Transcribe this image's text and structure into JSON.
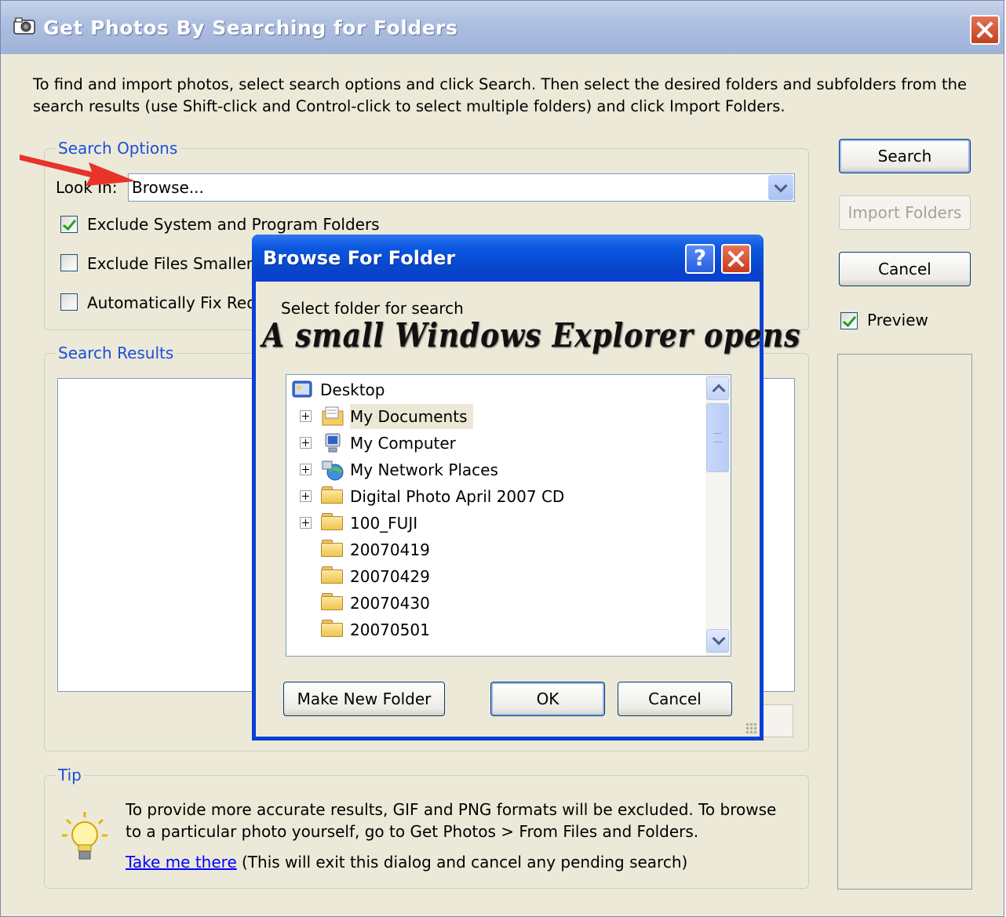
{
  "window": {
    "title": "Get Photos By Searching for Folders",
    "intro_text": "To find and import photos, select search options and click Search. Then select the desired folders and subfolders from the search results (use Shift-click and Control-click to select multiple folders) and click Import Folders."
  },
  "search_options": {
    "legend": "Search Options",
    "look_in_label": "Look In:",
    "look_in_value": "Browse...",
    "exclude_system_label": "Exclude System and Program Folders",
    "exclude_system_checked": true,
    "exclude_small_label": "Exclude Files Smaller T",
    "exclude_small_checked": false,
    "auto_fix_label": "Automatically Fix Red",
    "auto_fix_checked": false
  },
  "search_results": {
    "legend": "Search Results"
  },
  "right_panel": {
    "search_button": "Search",
    "import_button": "Import Folders",
    "cancel_button": "Cancel",
    "preview_label": "Preview",
    "preview_checked": true
  },
  "tip": {
    "legend": "Tip",
    "text": "To provide more accurate results, GIF and PNG formats will be excluded. To browse to a particular photo yourself, go to Get Photos > From Files and Folders.",
    "link_text": "Take me there",
    "link_note": "(This will exit this dialog and cancel any pending search)"
  },
  "browse_dialog": {
    "title": "Browse For Folder",
    "help_label": "?",
    "prompt": "Select folder for search",
    "annotation": "A small Windows Explorer opens",
    "tree": [
      {
        "label": "Desktop",
        "icon": "desktop-icon",
        "expandable": false
      },
      {
        "label": "My Documents",
        "icon": "my-documents-icon",
        "expandable": true,
        "selected": true
      },
      {
        "label": "My Computer",
        "icon": "my-computer-icon",
        "expandable": true
      },
      {
        "label": "My Network Places",
        "icon": "network-places-icon",
        "expandable": true
      },
      {
        "label": "Digital Photo April 2007 CD",
        "icon": "folder-icon",
        "expandable": true
      },
      {
        "label": "100_FUJI",
        "icon": "folder-icon",
        "expandable": true
      },
      {
        "label": "20070419",
        "icon": "folder-icon",
        "expandable": false
      },
      {
        "label": "20070429",
        "icon": "folder-icon",
        "expandable": false
      },
      {
        "label": "20070430",
        "icon": "folder-icon",
        "expandable": false
      },
      {
        "label": "20070501",
        "icon": "folder-icon",
        "expandable": false
      }
    ],
    "make_new_folder_button": "Make New Folder",
    "ok_button": "OK",
    "cancel_button": "Cancel"
  },
  "colors": {
    "xp_blue": "#0a3fd6",
    "legend_blue": "#1b4fd8",
    "arrow_red": "#e8322a",
    "dialog_bg": "#ece9d8"
  }
}
